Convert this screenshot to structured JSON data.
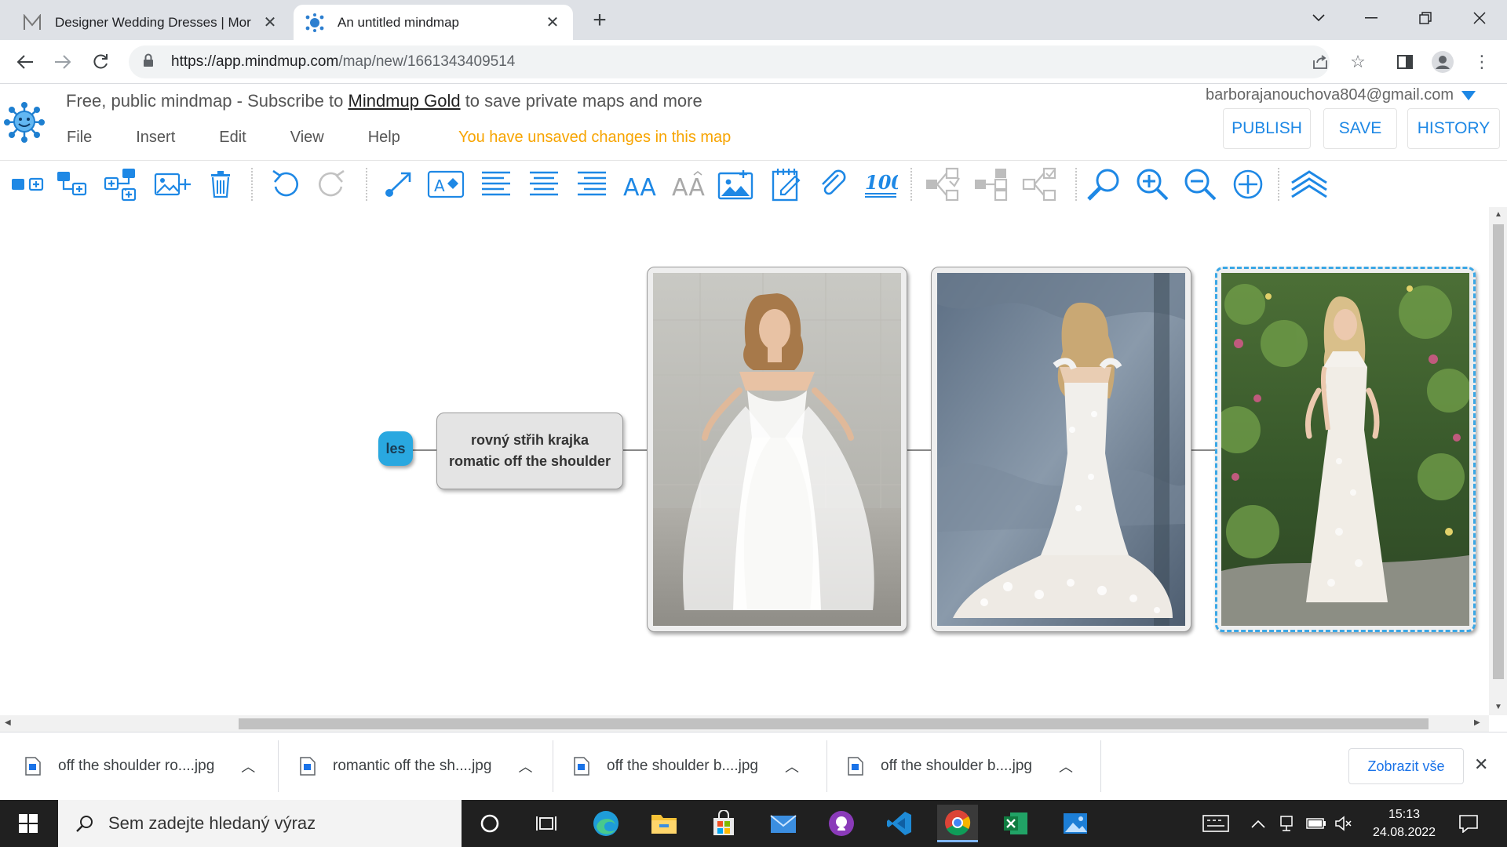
{
  "browser": {
    "tabs": [
      {
        "title": "Designer Wedding Dresses | Mor",
        "favicon": "morilee-m-icon",
        "active": false
      },
      {
        "title": "An untitled mindmap",
        "favicon": "mindmup-icon",
        "active": true
      }
    ],
    "url_host": "https://app.mindmup.com",
    "url_path": "/map/new/1661343409514"
  },
  "app": {
    "banner_prefix": "Free, public mindmap - Subscribe to ",
    "banner_link": "Mindmup Gold",
    "banner_suffix": " to save private maps and more",
    "menus": [
      "File",
      "Insert",
      "Edit",
      "View",
      "Help"
    ],
    "unsaved_notice": "You have unsaved changes in this map",
    "user_email": "barborajanouchova804@gmail.com",
    "buttons": {
      "publish": "PUBLISH",
      "save": "SAVE",
      "history": "HISTORY"
    },
    "accent_color": "#1e88e5",
    "warning_color": "#f7a400"
  },
  "toolbar_icons": [
    "add-sibling-icon",
    "add-child-icon",
    "add-multiple-icon",
    "add-image-icon",
    "delete-icon",
    "undo-icon",
    "redo-icon",
    "connect-icon",
    "text-style-icon",
    "align-left-icon",
    "align-center-icon",
    "align-right-icon",
    "font-bigger-icon",
    "font-smaller-icon",
    "image-icon",
    "note-icon",
    "link-icon",
    "progress-icon",
    "collapse-icon",
    "expand-icon",
    "reorganize-icon",
    "search-icon",
    "zoom-in-icon",
    "zoom-out-icon",
    "center-icon",
    "top-collapse-icon"
  ],
  "mindmap": {
    "root_label": "les",
    "text_node_label": "rovný střih krajka romatic off the shoulder",
    "image_nodes": [
      {
        "name": "dress-off-shoulder-overskirt",
        "selected": false
      },
      {
        "name": "dress-off-shoulder-back-lace",
        "selected": false
      },
      {
        "name": "dress-halter-lace-garden",
        "selected": true
      }
    ]
  },
  "downloads": {
    "items": [
      "off the shoulder ro....jpg",
      "romantic off the sh....jpg",
      "off the shoulder b....jpg",
      "off the shoulder b....jpg"
    ],
    "show_all": "Zobrazit vše"
  },
  "taskbar": {
    "search_placeholder": "Sem zadejte hledaný výraz",
    "apps": [
      "cortana-icon",
      "task-view-icon",
      "edge-icon",
      "file-explorer-icon",
      "store-icon",
      "mail-icon",
      "github-desktop-icon",
      "vscode-icon",
      "chrome-icon",
      "excel-icon",
      "photos-icon"
    ],
    "time": "15:13",
    "date": "24.08.2022"
  }
}
